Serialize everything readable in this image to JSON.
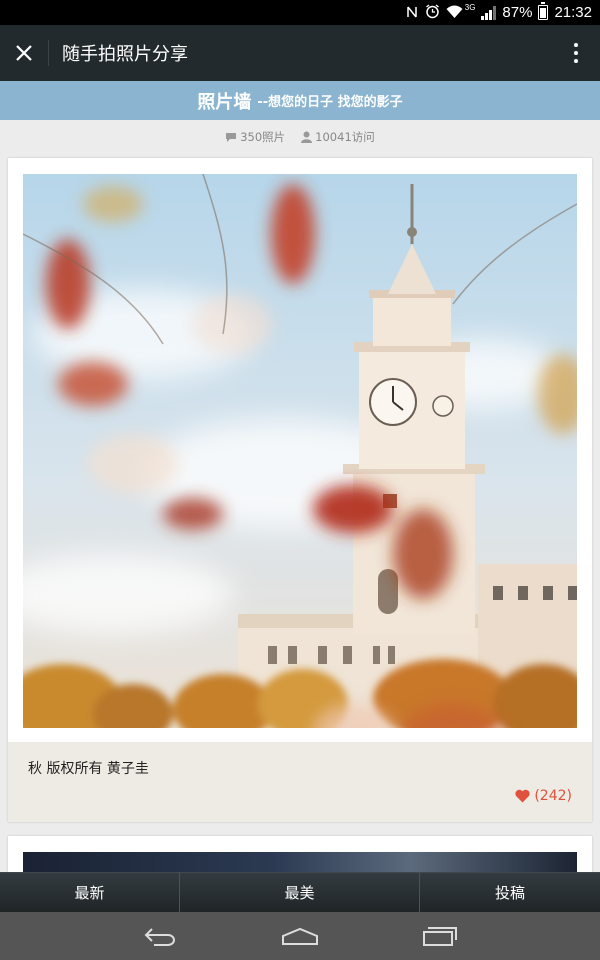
{
  "status_bar": {
    "battery": "87%",
    "time": "21:32",
    "network": "3G"
  },
  "app_bar": {
    "title": "随手拍照片分享"
  },
  "banner": {
    "title": "照片墙",
    "subtitle": "--想您的日子 找您的影子"
  },
  "stats": {
    "photos": "350照片",
    "visits": "10041访问"
  },
  "post": {
    "caption": "秋 版权所有 黄子圭",
    "likes": "(242)"
  },
  "tabs": [
    {
      "label": "最新"
    },
    {
      "label": "最美"
    },
    {
      "label": "投稿"
    }
  ],
  "colors": {
    "app_bar": "#232a2e",
    "banner": "#8ab4cf",
    "like": "#e0523d",
    "caption_bg": "#eeebe4"
  }
}
